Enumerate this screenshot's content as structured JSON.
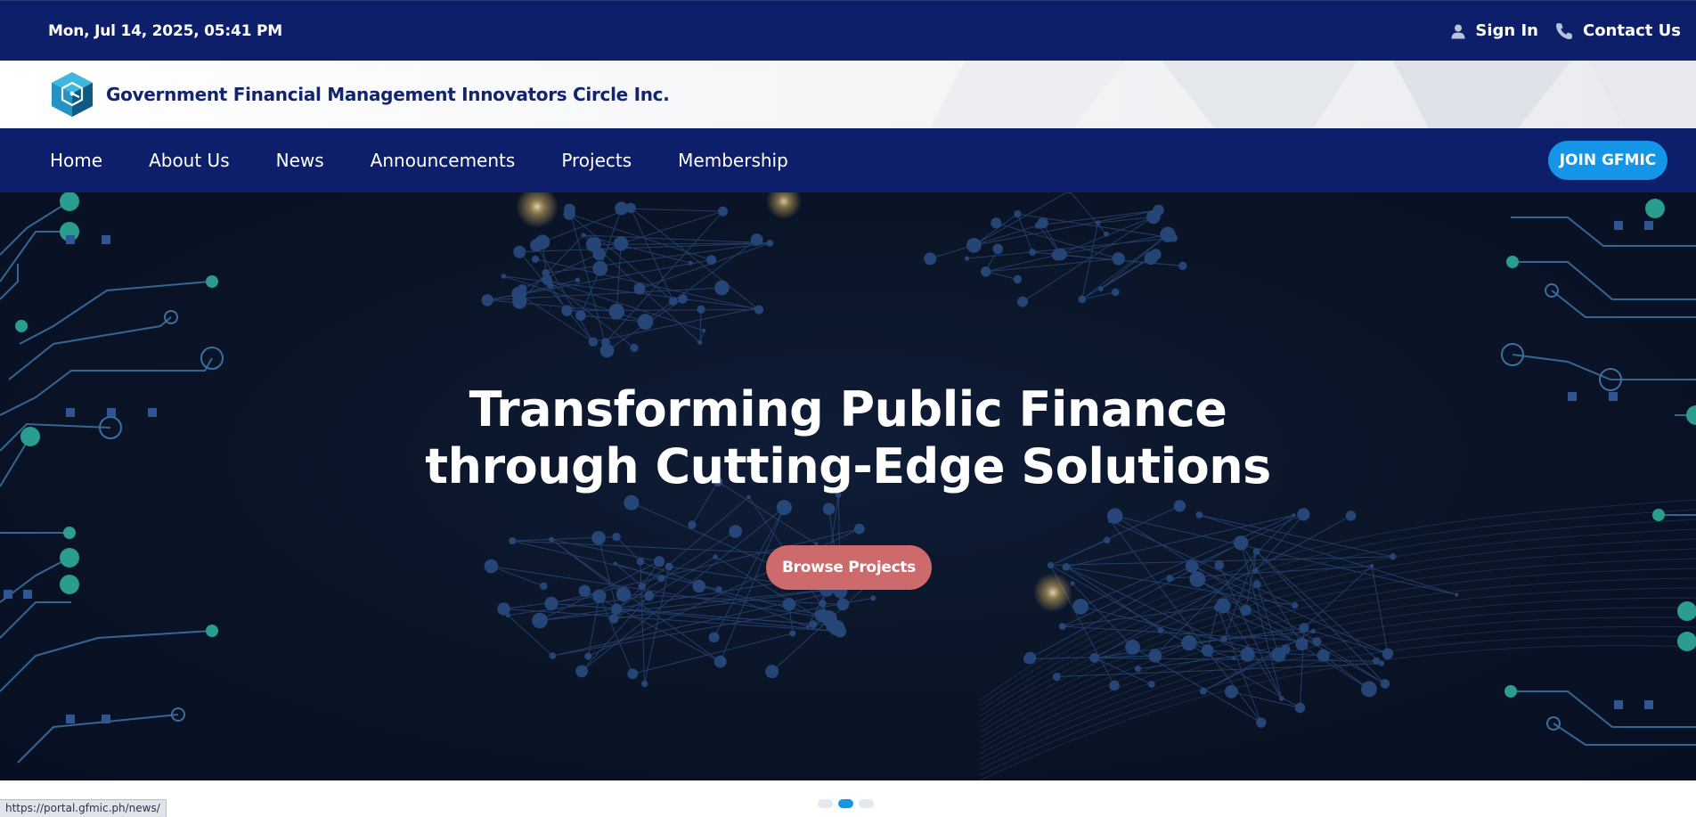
{
  "topbar": {
    "datetime": "Mon, Jul 14, 2025, 05:41 PM",
    "sign_in": "Sign In",
    "contact": "Contact Us",
    "icons": {
      "sign_in": "user-icon",
      "contact": "phone-icon"
    }
  },
  "brand": {
    "name": "Government Financial Management Innovators Circle Inc.",
    "logo_icon": "gfmic-cube-logo"
  },
  "nav": {
    "items": [
      "Home",
      "About Us",
      "News",
      "Announcements",
      "Projects",
      "Membership"
    ],
    "join_label": "JOIN GFMIC"
  },
  "hero": {
    "title_line1": "Transforming Public Finance",
    "title_line2": "through Cutting-Edge Solutions",
    "cta_label": "Browse Projects"
  },
  "carousel": {
    "slide_count": 3,
    "active_index": 1
  },
  "status_url": "https://portal.gfmic.ph/news/",
  "colors": {
    "navy": "#0d1f6b",
    "accent_blue": "#1595e8",
    "cta_red": "#cd6a6b",
    "circuit_teal": "#2a9d8f"
  }
}
